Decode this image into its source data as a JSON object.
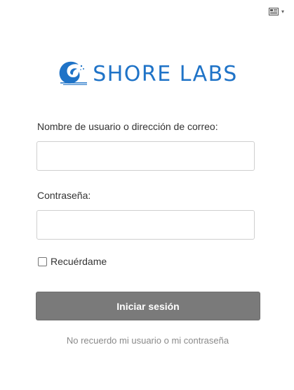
{
  "language_switcher": {
    "icon": "language-flag-icon",
    "caret_icon": "caret-down-icon",
    "caret": "▾"
  },
  "logo": {
    "icon": "wave-icon",
    "text": "SHORE LABS",
    "color": "#1f73c7"
  },
  "form": {
    "username_label": "Nombre de usuario o dirección de correo:",
    "username_value": "",
    "password_label": "Contraseña:",
    "password_value": "",
    "remember_label": "Recuérdame",
    "remember_checked": false,
    "submit_label": "Iniciar sesión",
    "submit_color": "#7a7a7a",
    "forgot_link": "No recuerdo mi usuario o mi contraseña"
  }
}
